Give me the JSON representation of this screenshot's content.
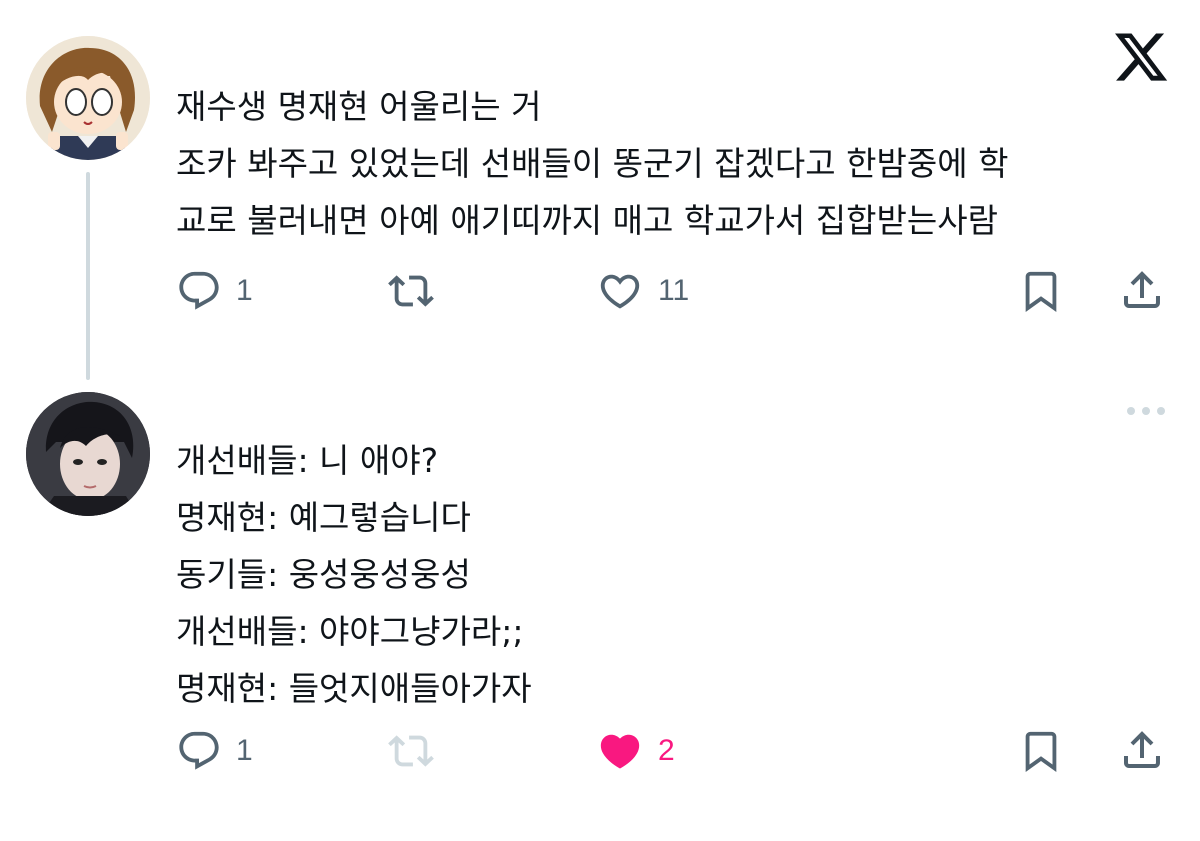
{
  "tweet1": {
    "lines": [
      "재수생 명재현 어울리는 거",
      "조카 봐주고 있었는데 선배들이 똥군기 잡겠다고 한밤중에 학",
      "교로 불러내면 아예 애기띠까지 매고 학교가서 집합받는사람"
    ],
    "reply_count": "1",
    "like_count": "11"
  },
  "tweet2": {
    "lines": [
      "개선배들: 니 애야?",
      "명재현: 예그렇습니다",
      "동기들: 웅성웅성웅성",
      "개선배들: 야야그냥가라;;",
      "명재현: 들엇지애들아가자"
    ],
    "reply_count": "1",
    "like_count": "2"
  },
  "colors": {
    "icon_gray": "#536471",
    "like_pink": "#f91880",
    "thread_line": "#cfd9de",
    "retweet_disabled": "#cfd9de"
  },
  "icons": {
    "brand": "x-logo-icon",
    "reply": "reply-icon",
    "retweet": "retweet-icon",
    "like": "like-icon",
    "bookmark": "bookmark-icon",
    "share": "share-icon",
    "more": "more-icon"
  }
}
